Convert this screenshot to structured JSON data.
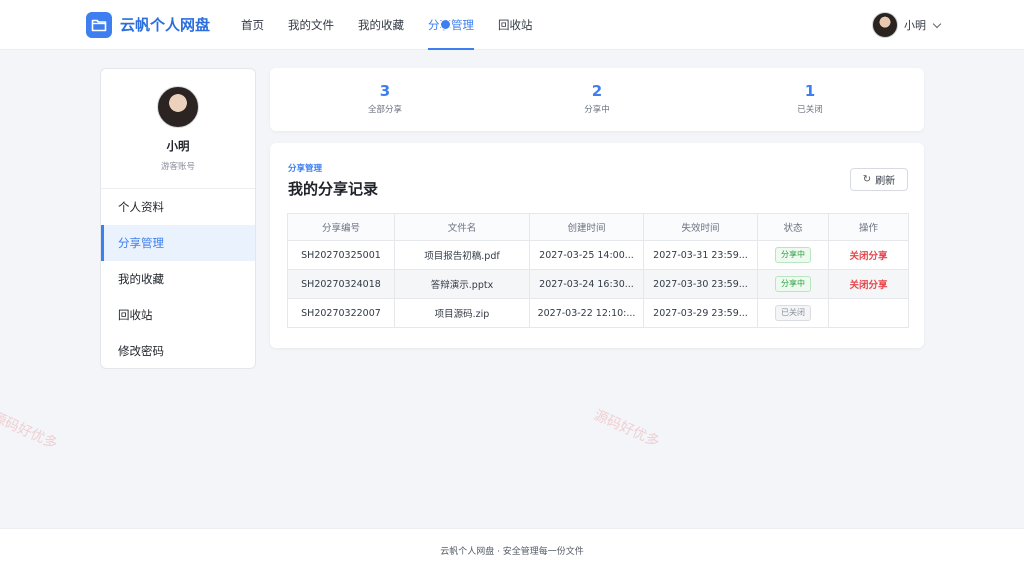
{
  "header": {
    "brand": "云帆个人网盘",
    "nav": [
      "首页",
      "我的文件",
      "我的收藏",
      "分享管理",
      "回收站"
    ],
    "active_nav": "分享管理",
    "user_name": "小明"
  },
  "sidebar": {
    "name": "小明",
    "role": "游客账号",
    "items": [
      "个人资料",
      "分享管理",
      "我的收藏",
      "回收站",
      "修改密码"
    ],
    "active": "分享管理"
  },
  "stats": [
    {
      "value": "3",
      "label": "全部分享"
    },
    {
      "value": "2",
      "label": "分享中"
    },
    {
      "value": "1",
      "label": "已关闭"
    }
  ],
  "shares": {
    "eyebrow": "分享管理",
    "title": "我的分享记录",
    "refresh_label": "刷新",
    "columns": [
      "分享编号",
      "文件名",
      "创建时间",
      "失效时间",
      "状态",
      "操作"
    ],
    "rows": [
      {
        "id": "SH20270325001",
        "file": "项目报告初稿.pdf",
        "created": "2027-03-25 14:00...",
        "expires": "2027-03-31 23:59...",
        "status": "分享中",
        "action": "关闭分享"
      },
      {
        "id": "SH20270324018",
        "file": "答辩演示.pptx",
        "created": "2027-03-24 16:30...",
        "expires": "2027-03-30 23:59...",
        "status": "分享中",
        "action": "关闭分享"
      },
      {
        "id": "SH20270322007",
        "file": "项目源码.zip",
        "created": "2027-03-22 12:10:...",
        "expires": "2027-03-29 23:59...",
        "status": "已关闭",
        "action": ""
      }
    ]
  },
  "footer": "云帆个人网盘 · 安全管理每一份文件",
  "watermark": "源码好优多",
  "colors": {
    "accent": "#3d7ff0",
    "danger": "#e5484d",
    "success": "#2f9e44"
  },
  "icons": {
    "logo": "folder-icon",
    "refresh": "refresh-icon",
    "dropdown": "chevron-down-icon"
  }
}
